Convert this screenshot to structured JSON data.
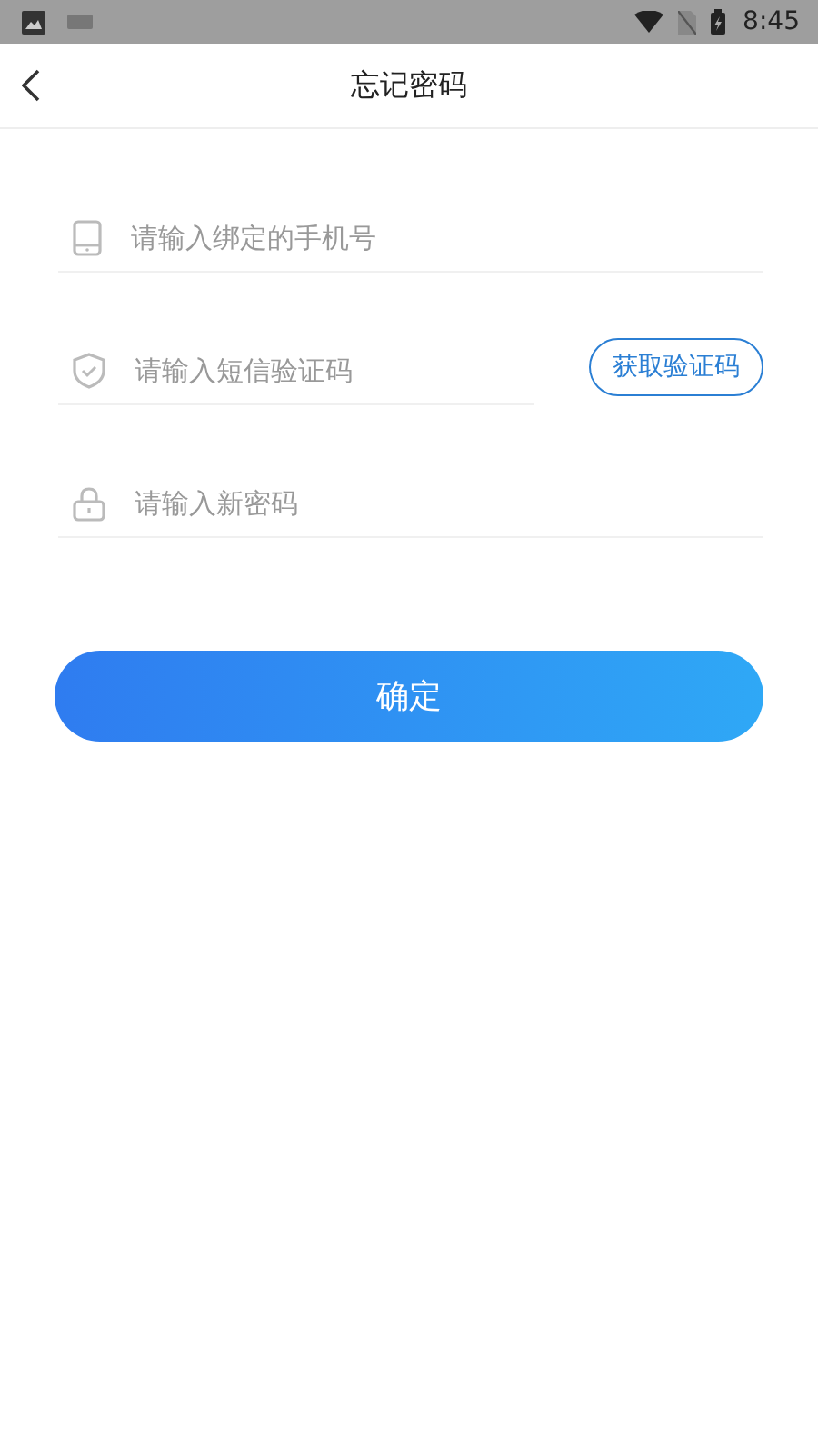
{
  "status_bar": {
    "time": "8:45"
  },
  "header": {
    "title": "忘记密码"
  },
  "fields": [
    {
      "kind": "phone",
      "placeholder": "请输入绑定的手机号"
    },
    {
      "kind": "shield",
      "placeholder": "请输入短信验证码",
      "action": "获取验证码"
    },
    {
      "kind": "lock",
      "placeholder": "请输入新密码"
    }
  ],
  "submit": "确定"
}
